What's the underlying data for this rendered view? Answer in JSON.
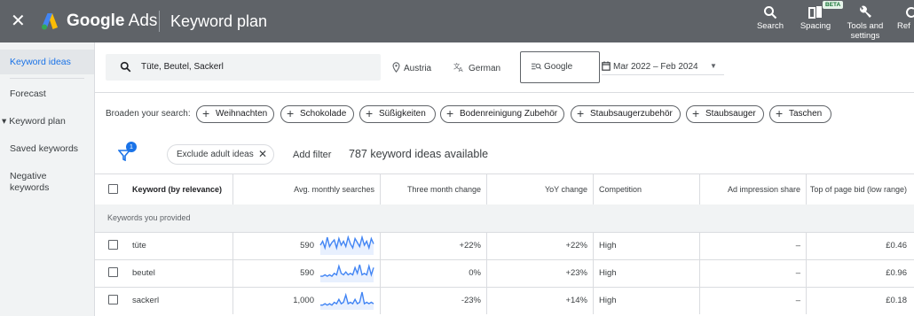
{
  "topbar": {
    "close_icon": "close-icon",
    "brand_bold": "Google",
    "brand_rest": " Ads",
    "page_title": "Keyword plan",
    "actions": [
      {
        "label": "Search",
        "icon": "search-icon"
      },
      {
        "label": "Spacing",
        "icon": "spacing-icon",
        "badge": "BETA"
      },
      {
        "label": "Tools and settings",
        "icon": "wrench-icon"
      },
      {
        "label": "Ref",
        "icon": "refresh-icon"
      }
    ]
  },
  "sidebar": {
    "items": [
      {
        "label": "Keyword ideas",
        "active": true
      },
      {
        "label": "Forecast"
      },
      {
        "label": "▾ Keyword plan"
      },
      {
        "label": "Saved keywords"
      },
      {
        "label": "Negative keywords"
      }
    ]
  },
  "search": {
    "value": "Tüte, Beutel, Sackerl",
    "location": "Austria",
    "language": "German",
    "network": "Google",
    "date_range": "Mar 2022 – Feb 2024"
  },
  "broaden": {
    "label": "Broaden your search:",
    "chips": [
      "Weihnachten",
      "Schokolade",
      "Süßigkeiten",
      "Bodenreinigung Zubehör",
      "Staubsaugerzubehör",
      "Staubsauger",
      "Taschen"
    ]
  },
  "filters": {
    "badge_count": "1",
    "exclude_chip": "Exclude adult ideas",
    "add_filter": "Add filter",
    "available": "787 keyword ideas available"
  },
  "table": {
    "headers": [
      "Keyword (by relevance)",
      "Avg. monthly searches",
      "Three month change",
      "YoY change",
      "Competition",
      "Ad impression share",
      "Top of page bid (low range)"
    ],
    "group_label": "Keywords you provided",
    "rows": [
      {
        "keyword": "tüte",
        "avg": "590",
        "three_month": "+22%",
        "yoy": "+22%",
        "competition": "High",
        "impression": "–",
        "bid": "£0.46",
        "trend": [
          6,
          9,
          4,
          12,
          5,
          8,
          10,
          4,
          11,
          6,
          9,
          5,
          12,
          7,
          4,
          11,
          8,
          5,
          12,
          6,
          9,
          4,
          11,
          7
        ]
      },
      {
        "keyword": "beutel",
        "avg": "590",
        "three_month": "0%",
        "yoy": "+23%",
        "competition": "High",
        "impression": "–",
        "bid": "£0.96",
        "trend": [
          3,
          3,
          4,
          3,
          4,
          3,
          5,
          4,
          10,
          5,
          4,
          6,
          4,
          5,
          4,
          9,
          5,
          11,
          4,
          5,
          4,
          10,
          4,
          9
        ]
      },
      {
        "keyword": "sackerl",
        "avg": "1,000",
        "three_month": "-23%",
        "yoy": "+14%",
        "competition": "High",
        "impression": "–",
        "bid": "£0.18",
        "trend": [
          2,
          2,
          3,
          2,
          3,
          2,
          4,
          3,
          6,
          3,
          4,
          9,
          3,
          4,
          3,
          6,
          3,
          4,
          11,
          3,
          4,
          3,
          4,
          3
        ]
      }
    ]
  },
  "colors": {
    "topbar": "#5f6368",
    "accent": "#1a73e8",
    "sparkline": "#4285f4"
  }
}
